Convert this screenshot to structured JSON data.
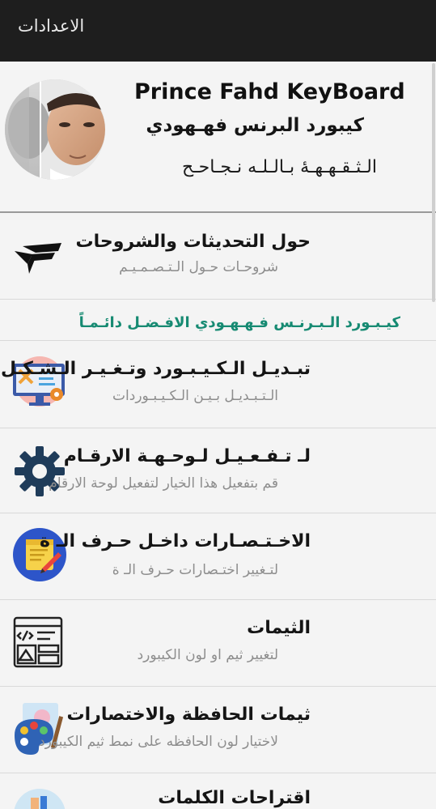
{
  "appbar": {
    "title": "الاعدادات"
  },
  "header": {
    "brand_en": "Prince Fahd KeyBoard",
    "brand_ar": "كيبورد البرنس فهـهودي",
    "slogan": "الـثـقـهـهـهٔ بـالـلـه نـجـاحـح"
  },
  "promo": {
    "text": "كيـبـورد الـبـرنـس فـهـهـودي الافـضـل دائـمـاً",
    "color": "#168a72"
  },
  "rows": [
    {
      "title": "حول التحديثات والشروحات",
      "subtitle": "شروحـات حـول الـتـصـمـيـم",
      "icon": "pf-logo-icon"
    },
    {
      "title": "تبـديـل الـكـيـبـورد وتـغـيـر الـشـكـل",
      "subtitle": "الـتـبـديـل بـيـن الـكـيـبـوردات",
      "icon": "monitor-tools-icon"
    },
    {
      "title": "لـ تـفـعـيـل لـوحـهـة الارقـام",
      "subtitle": "قم بتفعيل هذا الخيار لتفعيل لوحة الارقام",
      "icon": "gear-icon"
    },
    {
      "title": "الاخـتـصـارات داخـل حـرف الـ ة",
      "subtitle": "لتـغيير اختـصارات حـرف الـ ة",
      "icon": "notepad-pencil-icon"
    },
    {
      "title": "الثيمات",
      "subtitle": "لتغيير ثيم او لون الكيبورد",
      "icon": "code-layout-icon"
    },
    {
      "title": "ثيمات الحافظة والاختصارات",
      "subtitle": "لاختيار لون الحافظه على نمط ثيم الكيبورد",
      "icon": "palette-icon"
    },
    {
      "title": "اقتراحات الكلمات",
      "subtitle": "",
      "icon": "suggestion-icon"
    }
  ]
}
